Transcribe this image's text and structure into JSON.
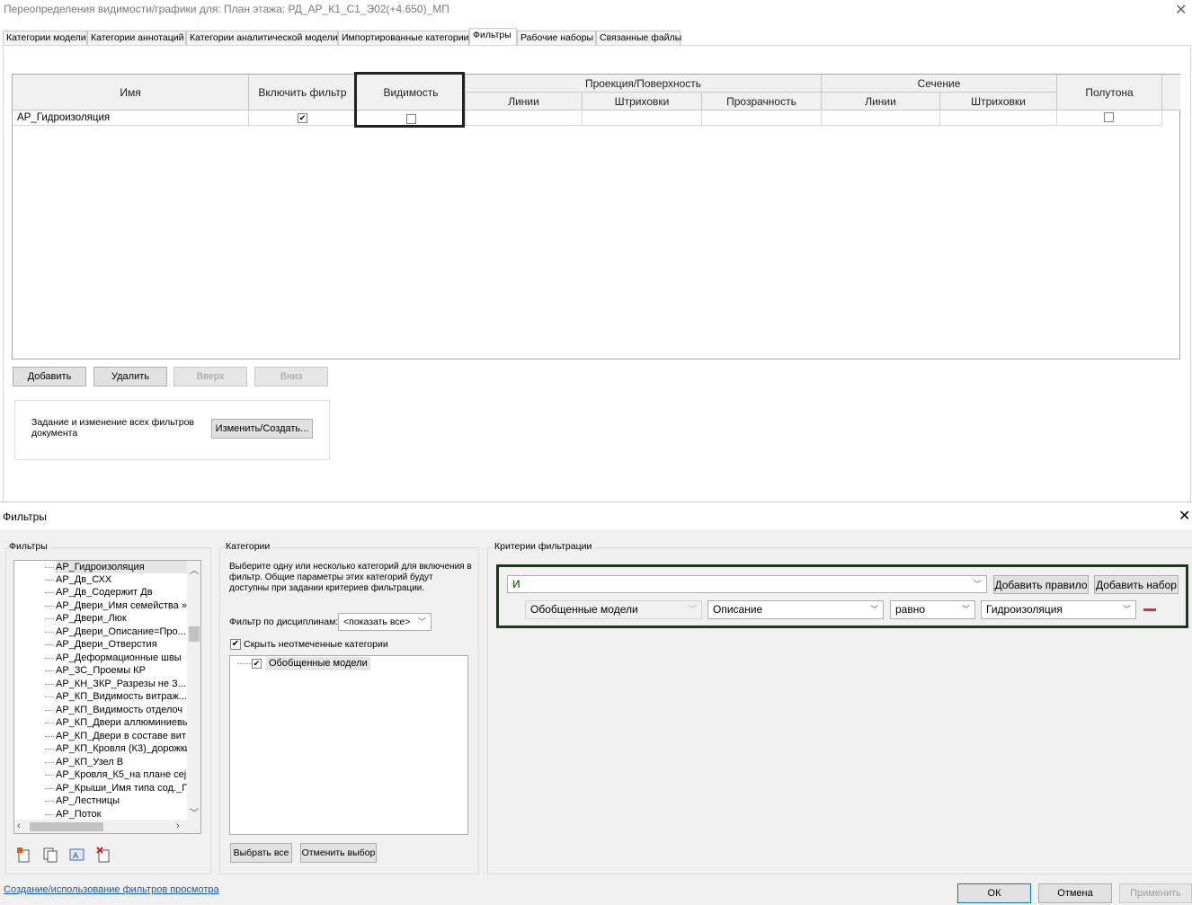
{
  "top": {
    "title": "Переопределения видимости/графики для: План этажа: РД_АР_К1_С1_Э02(+4.650)_МП",
    "close": "✕",
    "tabs": [
      {
        "label": "Категории модели"
      },
      {
        "label": "Категории аннотаций"
      },
      {
        "label": "Категории аналитической модели"
      },
      {
        "label": "Импортированные категории"
      },
      {
        "label": "Фильтры"
      },
      {
        "label": "Рабочие наборы"
      },
      {
        "label": "Связанные файлы"
      }
    ],
    "table": {
      "headers": {
        "name": "Имя",
        "enable": "Включить фильтр",
        "visibility": "Видимость",
        "projection": "Проекция/Поверхность",
        "proj_lines": "Линии",
        "proj_patterns": "Штриховки",
        "transparency": "Прозрачность",
        "section": "Сечение",
        "sec_lines": "Линии",
        "sec_patterns": "Штриховки",
        "halftone": "Полутона"
      },
      "rows": [
        {
          "name": "АР_Гидроизоляция",
          "enabled": "✔",
          "visible": "",
          "halftone": ""
        }
      ]
    },
    "buttons": {
      "add": "Добавить",
      "delete": "Удалить",
      "up": "Вверх",
      "down": "Вниз"
    },
    "doc_filters": {
      "text": "Задание и изменение всех фильтров документа",
      "button": "Изменить/Создать..."
    }
  },
  "bottom": {
    "title": "Фильтры",
    "close": "✕",
    "filters_group": "Фильтры",
    "filter_items": [
      "АР_Гидроизоляция",
      "АР_Дв_СХХ",
      "АР_Дв_Содержит Дв",
      "АР_Двери_Имя семейства »",
      "АР_Двери_Люк",
      "АР_Двери_Описание=Про...",
      "АР_Двери_Отверстия",
      "АР_Деформационные швы",
      "АР_ЗС_Проемы КР",
      "АР_КН_ЗКР_Разрезы не З...",
      "АР_КП_Видимость витраж...",
      "АР_КП_Видимость отделоч",
      "АР_КП_Двери аллюминиевы",
      "АР_КП_Двери в составе вит",
      "АР_КП_Кровля (К3)_дорожки",
      "АР_КП_Узел В",
      "АР_Кровля_К5_на плане сеј",
      "АР_Крыши_Имя типа сод._П",
      "АР_Лестницы",
      "АР_Поток"
    ],
    "categories_group": "Категории",
    "categories_text": "Выберите одну или несколько категорий для включения в фильтр. Общие параметры этих категорий будут доступны при задании критериев фильтрации.",
    "discipline_label": "Фильтр по дисциплинам:",
    "discipline_value": "<показать все>",
    "hide_unchecked": "Скрыть неотмеченные категории",
    "hide_checked": "✔",
    "category_item": "Обобщенные модели",
    "category_checked": "✔",
    "select_all": "Выбрать все",
    "deselect": "Отменить выбор",
    "criteria_group": "Критерии фильтрации",
    "logic": "И",
    "add_rule": "Добавить правило",
    "add_set": "Добавить набор",
    "rule": {
      "category": "Обобщенные модели",
      "parameter": "Описание",
      "operator": "равно",
      "value": "Гидроизоляция"
    },
    "link": "Создание/использование фильтров просмотра",
    "ok": "ОК",
    "cancel": "Отмена",
    "apply": "Применить"
  },
  "colors": {
    "highlight_border": "#222222",
    "criteria_border": "#253325",
    "logic_text": "#3c7a2b",
    "remove_rule": "#e03232",
    "link": "#1a55c4"
  }
}
